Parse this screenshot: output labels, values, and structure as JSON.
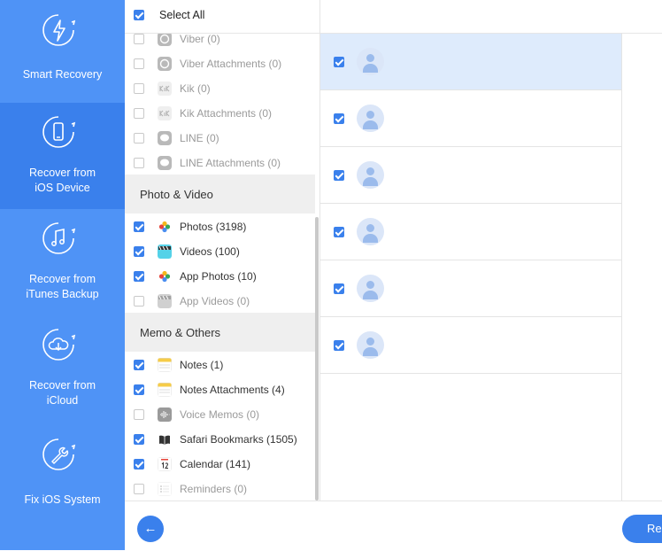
{
  "sidebar": {
    "items": [
      {
        "label_1": "Smart Recovery",
        "label_2": "",
        "icon": "lightning-refresh-icon",
        "active": false
      },
      {
        "label_1": "Recover from",
        "label_2": "iOS Device",
        "icon": "phone-refresh-icon",
        "active": true
      },
      {
        "label_1": "Recover from",
        "label_2": "iTunes Backup",
        "icon": "music-refresh-icon",
        "active": false
      },
      {
        "label_1": "Recover from",
        "label_2": "iCloud",
        "icon": "cloud-download-icon",
        "active": false
      },
      {
        "label_1": "Fix iOS System",
        "label_2": "",
        "icon": "wrench-refresh-icon",
        "active": false
      }
    ]
  },
  "categories": {
    "select_all_label": "Select All",
    "select_all_checked": true,
    "top_rows": [
      {
        "label": "Viber (0)",
        "checked": false,
        "icon": "viber-icon"
      },
      {
        "label": "Viber Attachments (0)",
        "checked": false,
        "icon": "viber-icon"
      },
      {
        "label": "Kik (0)",
        "checked": false,
        "icon": "kik-icon"
      },
      {
        "label": "Kik Attachments (0)",
        "checked": false,
        "icon": "kik-icon"
      },
      {
        "label": "LINE (0)",
        "checked": false,
        "icon": "line-icon"
      },
      {
        "label": "LINE Attachments (0)",
        "checked": false,
        "icon": "line-icon"
      }
    ],
    "photo_section": {
      "title": "Photo & Video",
      "rows": [
        {
          "label": "Photos (3198)",
          "checked": true,
          "icon": "photos-icon"
        },
        {
          "label": "Videos (100)",
          "checked": true,
          "icon": "videos-icon"
        },
        {
          "label": "App Photos (10)",
          "checked": true,
          "icon": "photos-icon"
        },
        {
          "label": "App Videos (0)",
          "checked": false,
          "icon": "videos-icon"
        }
      ]
    },
    "memo_section": {
      "title": "Memo & Others",
      "rows": [
        {
          "label": "Notes (1)",
          "checked": true,
          "icon": "notes-icon"
        },
        {
          "label": "Notes Attachments (4)",
          "checked": true,
          "icon": "notes-icon"
        },
        {
          "label": "Voice Memos (0)",
          "checked": false,
          "icon": "voice-memo-icon"
        },
        {
          "label": "Safari Bookmarks (1505)",
          "checked": true,
          "icon": "bookmark-icon"
        },
        {
          "label": "Calendar (141)",
          "checked": true,
          "icon": "calendar-icon"
        },
        {
          "label": "Reminders (0)",
          "checked": false,
          "icon": "reminders-icon"
        }
      ]
    }
  },
  "items": {
    "rows": [
      {
        "checked": true,
        "selected": true
      },
      {
        "checked": true,
        "selected": false
      },
      {
        "checked": true,
        "selected": false
      },
      {
        "checked": true,
        "selected": false
      },
      {
        "checked": true,
        "selected": false
      },
      {
        "checked": true,
        "selected": false
      }
    ]
  },
  "footer": {
    "back_glyph": "←",
    "recover_label": "Recover"
  },
  "colors": {
    "sidebar": "#4f93f6",
    "sidebar_active": "#3a80ec",
    "accent": "#3a80ec",
    "selected_row": "#deebfc"
  }
}
